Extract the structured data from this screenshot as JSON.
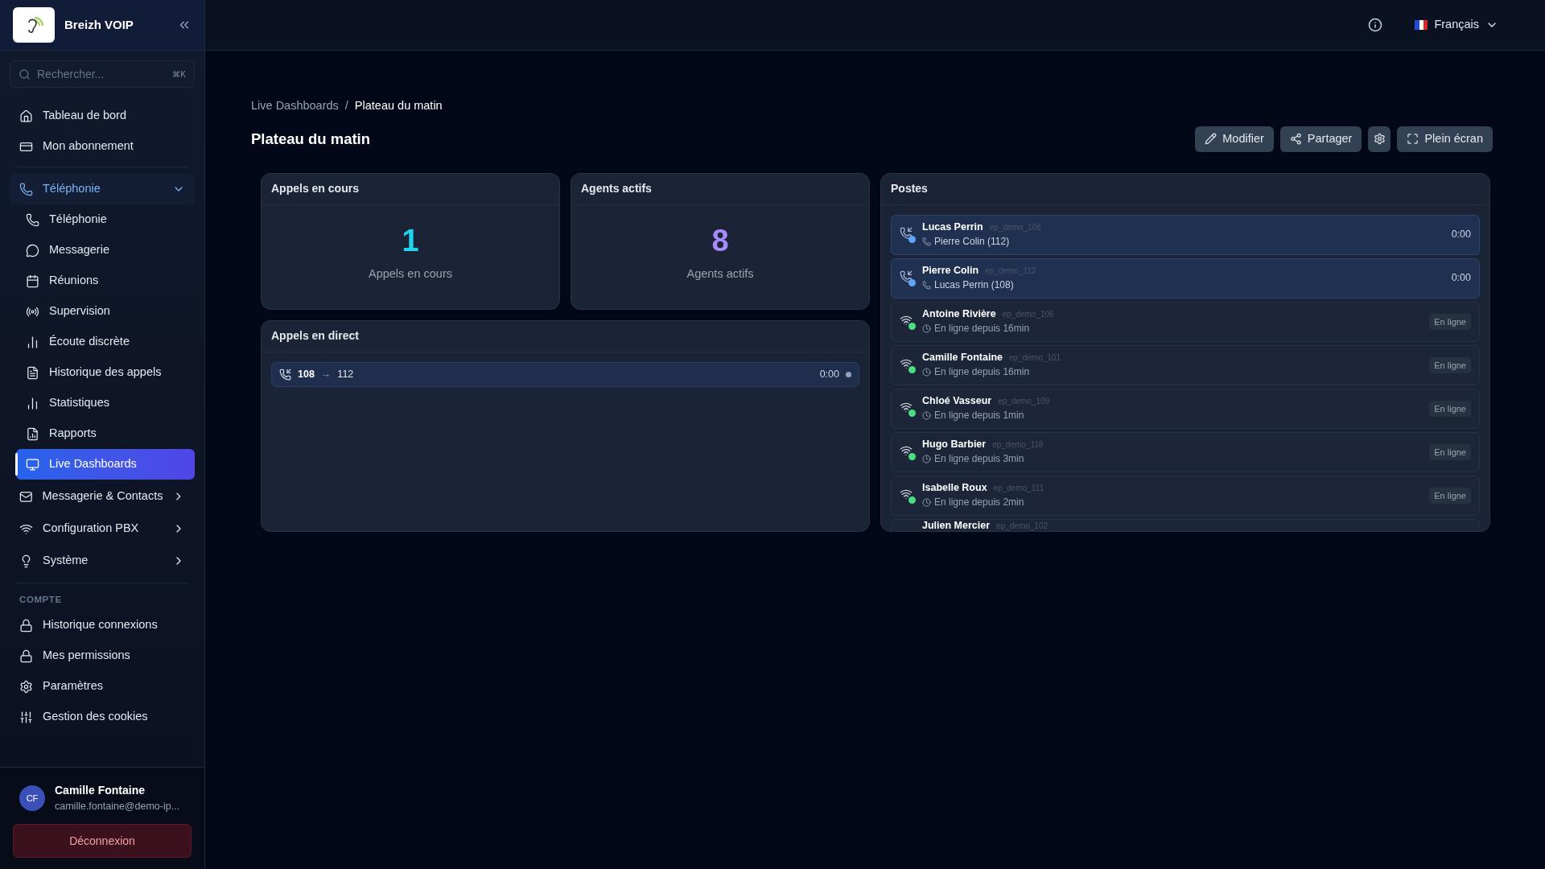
{
  "brand": {
    "name": "Breizh VOIP"
  },
  "search": {
    "placeholder": "Rechercher...",
    "shortcut": "⌘K"
  },
  "nav": [
    {
      "label": "Tableau de bord",
      "selected": false
    },
    {
      "label": "Mon abonnement",
      "selected": false
    },
    {
      "label": "Téléphonie",
      "kind": "group",
      "expanded": true,
      "children": [
        {
          "label": "Téléphonie",
          "selected": false
        },
        {
          "label": "Messagerie",
          "selected": false
        },
        {
          "label": "Réunions",
          "selected": false
        },
        {
          "label": "Supervision",
          "selected": false
        },
        {
          "label": "Écoute discrète",
          "selected": false
        },
        {
          "label": "Historique des appels",
          "selected": false
        },
        {
          "label": "Statistiques",
          "selected": false
        },
        {
          "label": "Rapports",
          "selected": false
        },
        {
          "label": "Live Dashboards",
          "selected": true
        }
      ]
    },
    {
      "label": "Messagerie & Contacts",
      "kind": "group",
      "expanded": false
    },
    {
      "label": "Configuration PBX",
      "kind": "group",
      "expanded": false
    },
    {
      "label": "Système",
      "kind": "group",
      "expanded": false
    }
  ],
  "account": {
    "heading": "COMPTE",
    "items": [
      {
        "label": "Historique connexions",
        "selected": false
      },
      {
        "label": "Mes permissions",
        "selected": false
      },
      {
        "label": "Paramètres",
        "selected": false
      },
      {
        "label": "Gestion des cookies",
        "selected": false
      }
    ]
  },
  "user": {
    "initials": "CF",
    "name": "Camille Fontaine",
    "email": "camille.fontaine@demo-ip..."
  },
  "logout": "Déconnexion",
  "language": "Français",
  "breadcrumb": [
    "Live Dashboards",
    "Plateau du matin"
  ],
  "breadcrumb_separator": "/",
  "title": "Plateau du matin",
  "actions": [
    "Modifier",
    "Partager",
    "Plein écran"
  ],
  "stats": [
    {
      "title": "Appels en cours",
      "value": "1",
      "label": "Appels en cours",
      "color": "#22d3ee"
    },
    {
      "title": "Agents actifs",
      "value": "8",
      "label": "Agents actifs",
      "color": "#a78bfa"
    }
  ],
  "live_calls": {
    "title": "Appels en direct",
    "calls": [
      {
        "from": "108",
        "arrow": "→",
        "to": "112",
        "time": "0:00"
      }
    ]
  },
  "postes": {
    "title": "Postes",
    "rows": [
      {
        "kind": "call",
        "name": "Lucas Perrin",
        "ext": "ep_demo_108",
        "detail": "Pierre Colin (112)",
        "time": "0:00"
      },
      {
        "kind": "call",
        "name": "Pierre Colin",
        "ext": "ep_demo_112",
        "detail": "Lucas Perrin (108)",
        "time": "0:00"
      },
      {
        "kind": "online",
        "name": "Antoine Rivière",
        "ext": "ep_demo_106",
        "detail": "En ligne depuis 16min",
        "status": "En ligne"
      },
      {
        "kind": "online",
        "name": "Camille Fontaine",
        "ext": "ep_demo_101",
        "detail": "En ligne depuis 16min",
        "status": "En ligne"
      },
      {
        "kind": "online",
        "name": "Chloé Vasseur",
        "ext": "ep_demo_109",
        "detail": "En ligne depuis 1min",
        "status": "En ligne"
      },
      {
        "kind": "online",
        "name": "Hugo Barbier",
        "ext": "ep_demo_118",
        "detail": "En ligne depuis 3min",
        "status": "En ligne"
      },
      {
        "kind": "online",
        "name": "Isabelle Roux",
        "ext": "ep_demo_111",
        "detail": "En ligne depuis 2min",
        "status": "En ligne"
      },
      {
        "kind": "partial",
        "name": "Julien Mercier",
        "ext": "ep_demo_102"
      }
    ]
  }
}
